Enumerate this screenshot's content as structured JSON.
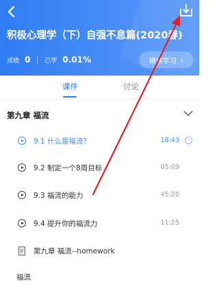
{
  "header": {
    "course_title": "积极心理学（下）自强不息篇(2020春)",
    "score_label": "成绩",
    "score_value": "0",
    "learned_label": "已学",
    "learned_value": "0.01%",
    "continue_label": "继续学习",
    "background_color": "#2f7df3"
  },
  "tabs": [
    {
      "label": "课件",
      "active": true
    },
    {
      "label": "讨论",
      "active": false
    }
  ],
  "chapter": {
    "title": "第九章 福流",
    "lessons": [
      {
        "title": "9.1 什么是福流?",
        "duration": "18:43",
        "active": true
      },
      {
        "title": "9.2 制定一个8周目标",
        "duration": "05:09",
        "active": false
      },
      {
        "title": "9.3 福流的能力",
        "duration": "45:20",
        "active": false
      },
      {
        "title": "9.4 提升你的福流力",
        "duration": "11:25",
        "active": false
      }
    ],
    "homework": "第九章 福流--homework",
    "footer_item": "福流"
  },
  "colors": {
    "accent": "#3a8cf5",
    "annotation_arrow": "#e02020"
  }
}
